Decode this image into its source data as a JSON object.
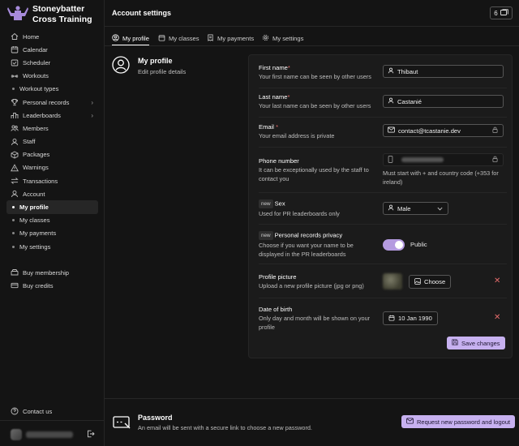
{
  "brand": {
    "name_line1": "Stoneybatter",
    "name_line2": "Cross Training"
  },
  "nav": {
    "items": [
      {
        "label": "Home",
        "icon": "home-icon"
      },
      {
        "label": "Calendar",
        "icon": "calendar-icon"
      },
      {
        "label": "Scheduler",
        "icon": "scheduler-icon"
      },
      {
        "label": "Workouts",
        "icon": "workouts-icon"
      },
      {
        "label": "Workout types",
        "icon": "dot"
      },
      {
        "label": "Personal records",
        "icon": "trophy-icon"
      },
      {
        "label": "Leaderboards",
        "icon": "leaderboard-icon"
      },
      {
        "label": "Members",
        "icon": "members-icon"
      },
      {
        "label": "Staff",
        "icon": "staff-icon"
      },
      {
        "label": "Packages",
        "icon": "packages-icon"
      },
      {
        "label": "Warnings",
        "icon": "warning-icon"
      },
      {
        "label": "Transactions",
        "icon": "transactions-icon"
      },
      {
        "label": "Account",
        "icon": "account-icon"
      },
      {
        "label": "My profile",
        "icon": "dot"
      },
      {
        "label": "My classes",
        "icon": "dot"
      },
      {
        "label": "My payments",
        "icon": "dot"
      },
      {
        "label": "My settings",
        "icon": "dot"
      }
    ],
    "bottom": [
      {
        "label": "Buy membership",
        "icon": "membership-icon"
      },
      {
        "label": "Buy credits",
        "icon": "credits-icon"
      }
    ],
    "contact": "Contact us"
  },
  "topbar": {
    "title": "Account settings",
    "badge_count": "6"
  },
  "tabs": [
    {
      "label": "My profile",
      "icon": "user-icon"
    },
    {
      "label": "My classes",
      "icon": "calendar-icon"
    },
    {
      "label": "My payments",
      "icon": "receipt-icon"
    },
    {
      "label": "My settings",
      "icon": "gear-icon"
    }
  ],
  "profile": {
    "title": "My profile",
    "subtitle": "Edit profile details"
  },
  "form": {
    "first_name": {
      "label": "First name",
      "desc": "Your first name can be seen by other users",
      "value": "Thibaut"
    },
    "last_name": {
      "label": "Last name",
      "desc": "Your last name can be seen by other users",
      "value": "Castanié"
    },
    "email": {
      "label": "Email",
      "desc": "Your email address is private",
      "value": "contact@tcastanie.dev"
    },
    "phone": {
      "label": "Phone number",
      "desc": "It can be exceptionally used by the staff to contact you",
      "hint": "Must start with + and country code (+353 for ireland)"
    },
    "sex": {
      "badge": "new",
      "label": "Sex",
      "desc": "Used for PR leaderboards only",
      "value": "Male"
    },
    "pr_privacy": {
      "badge": "new",
      "label": "Personal records privacy",
      "desc": "Choose if you want your name to be displayed in the PR leaderboards",
      "toggle_label": "Public",
      "enabled": true
    },
    "picture": {
      "label": "Profile picture",
      "desc": "Upload a new profile picture (jpg or png)",
      "button": "Choose"
    },
    "dob": {
      "label": "Date of birth",
      "desc": "Only day and month will be shown on your profile",
      "value": "10 Jan 1990"
    },
    "save_label": "Save changes"
  },
  "password": {
    "title": "Password",
    "desc": "An email will be sent with a secure link to choose a new password.",
    "button": "Request new password and logout"
  },
  "colors": {
    "accent": "#c7b1f0",
    "background": "#141414",
    "card": "#1b1b1b",
    "danger": "#e26a6a"
  }
}
